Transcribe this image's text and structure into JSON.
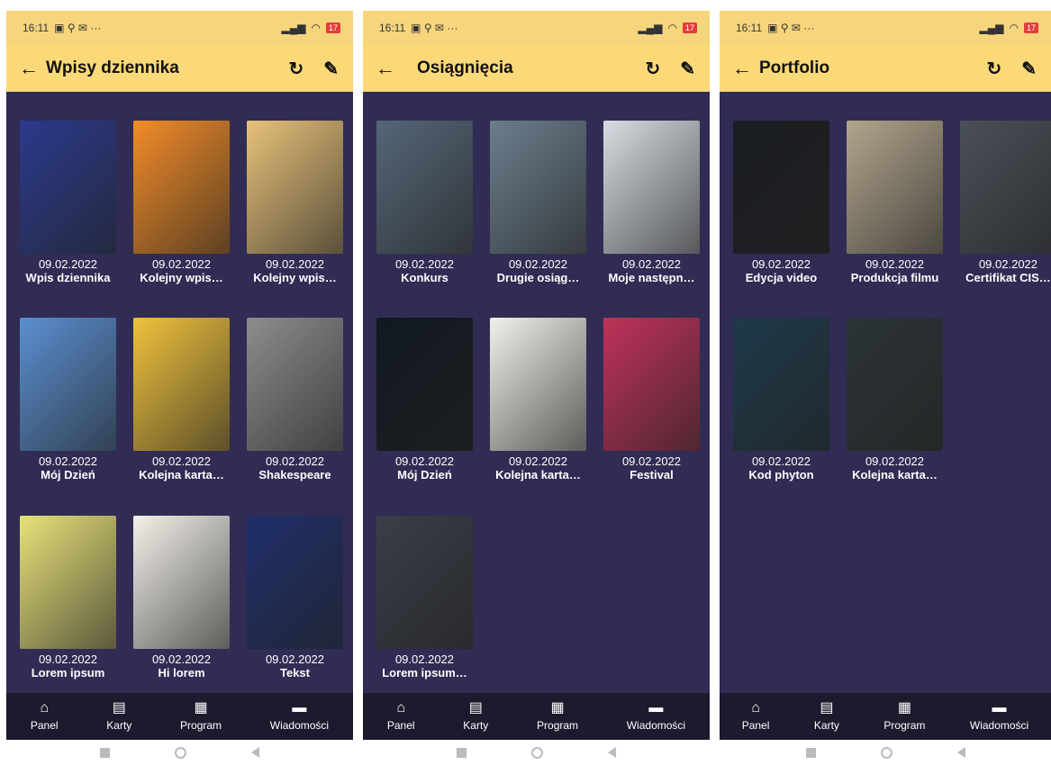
{
  "status_bar": {
    "time": "16:11",
    "indicators": "▣ ⚲ ✉ ···",
    "battery": "17"
  },
  "nav": {
    "items": [
      {
        "label": "Panel",
        "icon": "home-icon",
        "glyph": "⌂"
      },
      {
        "label": "Karty",
        "icon": "cards-icon",
        "glyph": "▤"
      },
      {
        "label": "Program",
        "icon": "program-icon",
        "glyph": "▦"
      },
      {
        "label": "Wiadomości",
        "icon": "messages-icon",
        "glyph": "▬"
      }
    ]
  },
  "screens": [
    {
      "title": "Wpisy dziennika",
      "items": [
        {
          "date": "09.02.2022",
          "label": "Wpis dziennika"
        },
        {
          "date": "09.02.2022",
          "label": "Kolejny wpis…"
        },
        {
          "date": "09.02.2022",
          "label": "Kolejny wpis…"
        },
        {
          "date": "09.02.2022",
          "label": "Mój Dzień"
        },
        {
          "date": "09.02.2022",
          "label": "Kolejna karta…"
        },
        {
          "date": "09.02.2022",
          "label": "Shakespeare"
        },
        {
          "date": "09.02.2022",
          "label": "Lorem ipsum"
        },
        {
          "date": "09.02.2022",
          "label": "Hi lorem"
        },
        {
          "date": "09.02.2022",
          "label": "Tekst"
        }
      ]
    },
    {
      "title": "Osiągnięcia",
      "items": [
        {
          "date": "09.02.2022",
          "label": "Konkurs"
        },
        {
          "date": "09.02.2022",
          "label": "Drugie osiąg…"
        },
        {
          "date": "09.02.2022",
          "label": "Moje następn…"
        },
        {
          "date": "09.02.2022",
          "label": "Mój Dzień"
        },
        {
          "date": "09.02.2022",
          "label": "Kolejna karta…"
        },
        {
          "date": "09.02.2022",
          "label": "Festival"
        },
        {
          "date": "09.02.2022",
          "label": "Lorem ipsum…"
        }
      ]
    },
    {
      "title": "Portfolio",
      "items": [
        {
          "date": "09.02.2022",
          "label": "Edycja video"
        },
        {
          "date": "09.02.2022",
          "label": "Produkcja filmu"
        },
        {
          "date": "09.02.2022",
          "label": "Certifikat CIS…"
        },
        {
          "date": "09.02.2022",
          "label": "Kod phyton"
        },
        {
          "date": "09.02.2022",
          "label": "Kolejna karta…"
        }
      ]
    }
  ],
  "colors": {
    "app_bar": "#fbd978",
    "status_bar": "#f6d57c",
    "content_bg": "#302c54",
    "nav_bg": "#1d1a2e",
    "thumbs": [
      [
        "#2b3a8c",
        "#f28c28",
        "#e8c27a",
        "#5a8fd0",
        "#f0c23c",
        "#8d8d8d",
        "#e8e27a",
        "#f4f1ea",
        "#1f2f6b"
      ],
      [
        "#556677",
        "#6b7d8c",
        "#d8dde3",
        "#101820",
        "#f2f0ea",
        "#c0325a",
        "#3a3e48"
      ],
      [
        "#1a1d22",
        "#b3a58d",
        "#4a5058",
        "#1e3a4a",
        "#2c3436"
      ]
    ]
  }
}
